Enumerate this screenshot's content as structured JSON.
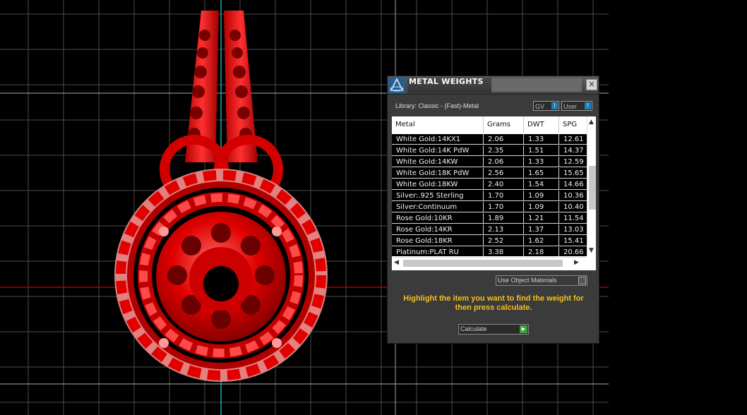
{
  "panel": {
    "title": "METAL WEIGHTS",
    "close_label": "×",
    "library_label": "Library: Classic - (Fast)-Metal",
    "toggle_gv": "GV",
    "toggle_user": "User",
    "toggle_mark": "!",
    "use_materials": "Use Object Materials",
    "hint": "Highlight the item you want to find the weight for then press calculate.",
    "calculate": "Calculate",
    "calculate_icon": "play-arrow"
  },
  "table": {
    "headers": [
      "Metal",
      "Grams",
      "DWT",
      "SPG"
    ],
    "rows": [
      [
        "White Gold:14KX1",
        "2.06",
        "1.33",
        "12.61"
      ],
      [
        "White Gold:14K PdW",
        "2.35",
        "1.51",
        "14.37"
      ],
      [
        "White Gold:14KW",
        "2.06",
        "1.33",
        "12.59"
      ],
      [
        "White Gold:18K PdW",
        "2.56",
        "1.65",
        "15.65"
      ],
      [
        "White Gold:18KW",
        "2.40",
        "1.54",
        "14.66"
      ],
      [
        "Silver:.925 Sterling",
        "1.70",
        "1.09",
        "10.36"
      ],
      [
        "Silver:Continuum",
        "1.70",
        "1.09",
        "10.40"
      ],
      [
        "Rose Gold:10KR",
        "1.89",
        "1.21",
        "11.54"
      ],
      [
        "Rose Gold:14KR",
        "2.13",
        "1.37",
        "13.03"
      ],
      [
        "Rose Gold:18KR",
        "2.52",
        "1.62",
        "15.41"
      ],
      [
        "Platinum:PLAT RU",
        "3.38",
        "2.18",
        "20.66"
      ]
    ]
  },
  "colors": {
    "viewport_bg": "#000000",
    "grid": "#5a5a5a",
    "model_red": "#e00000",
    "hint_text": "#f3c11a",
    "axis_cyan": "#1aa7a8"
  }
}
